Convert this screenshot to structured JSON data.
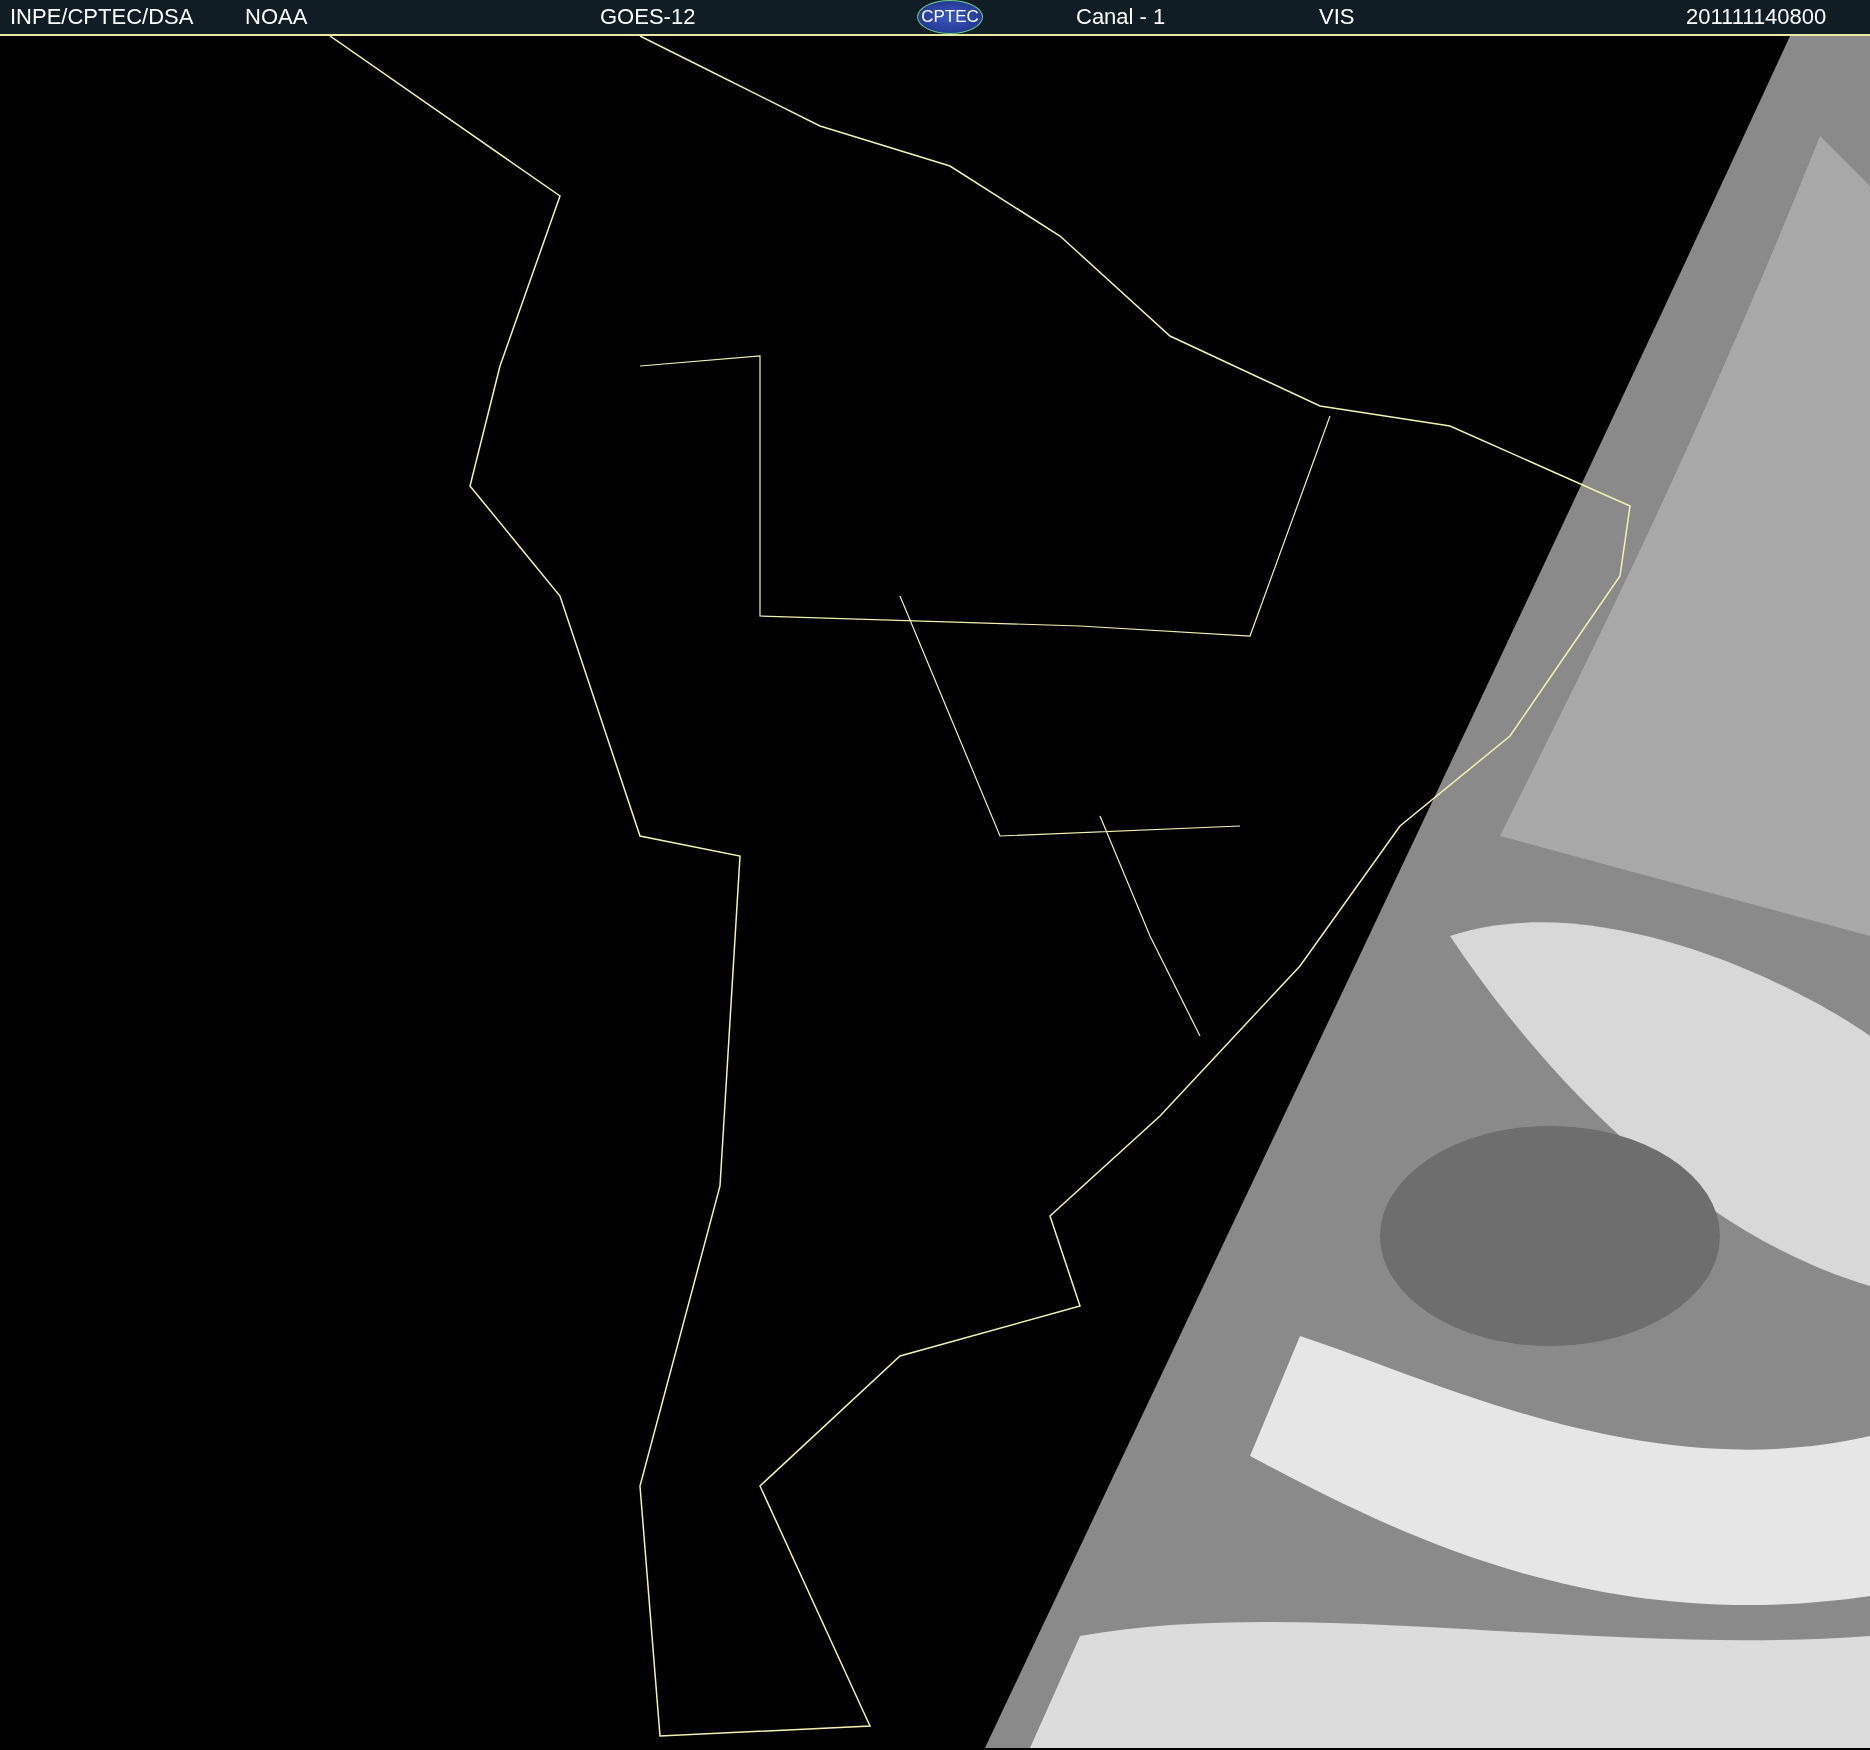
{
  "header": {
    "agency": "INPE/CPTEC/DSA",
    "source": "NOAA",
    "satellite": "GOES-12",
    "logo": "CPTEC",
    "channel": "Canal - 1",
    "band": "VIS",
    "timestamp": "201111140800"
  }
}
